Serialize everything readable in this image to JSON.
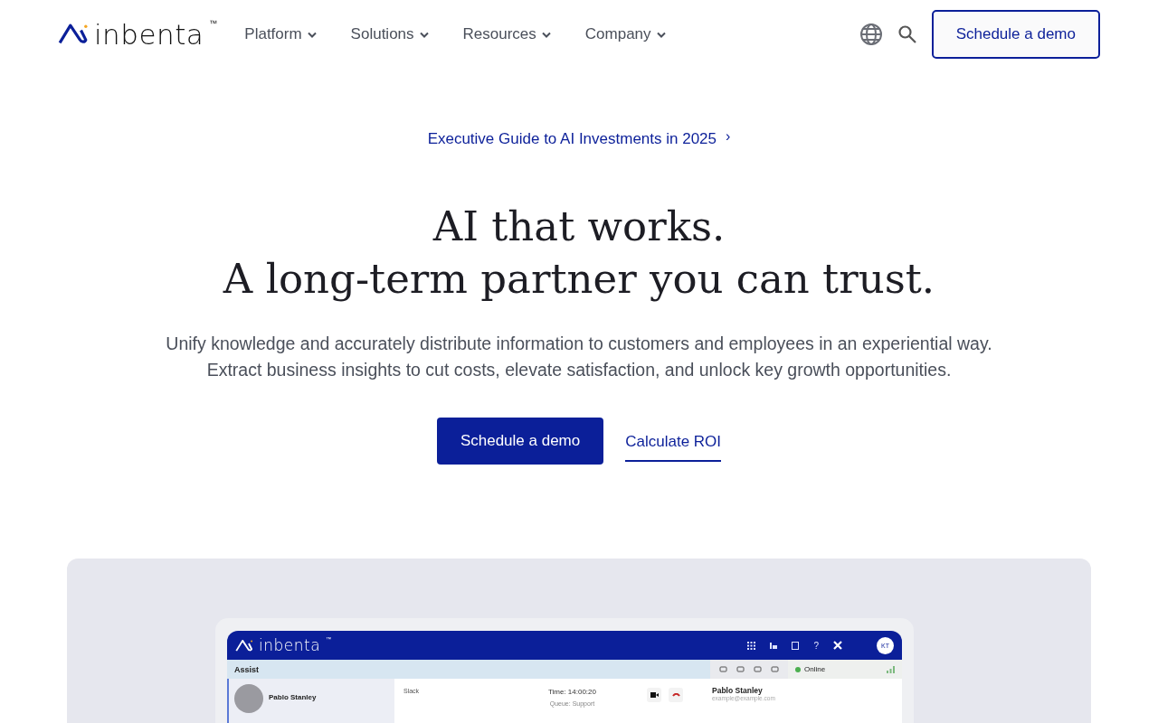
{
  "header": {
    "logo": {
      "name": "inbenta",
      "mark": "™"
    },
    "nav": [
      {
        "label": "Platform"
      },
      {
        "label": "Solutions"
      },
      {
        "label": "Resources"
      },
      {
        "label": "Company"
      }
    ],
    "cta": "Schedule a demo"
  },
  "announcement": {
    "label": "Executive Guide to AI Investments in 2025",
    "arrow": "›"
  },
  "hero": {
    "title_lines": [
      "AI that works.",
      "A long-term partner you can trust."
    ],
    "subtitle_lines": [
      "Unify knowledge and accurately distribute information to customers and employees in an experiential way.",
      "Extract business insights to cut costs, elevate satisfaction, and unlock key growth opportunities."
    ],
    "primary_button": "Schedule a demo",
    "secondary_link": "Calculate ROI"
  },
  "app_preview": {
    "logo": {
      "name": "inbenta",
      "mark": "™"
    },
    "top_icons": {
      "help": "?",
      "avatar": "KT"
    },
    "section": "Assist",
    "status": {
      "label": "Online",
      "color": "#4caf50"
    },
    "conversation": {
      "name": "Pablo Stanley",
      "channel": "Slack",
      "time": "Time: 14:00:20",
      "queue": "Queue: Support"
    },
    "contact": {
      "name": "Pablo Stanley",
      "email": "example@example.com"
    }
  }
}
